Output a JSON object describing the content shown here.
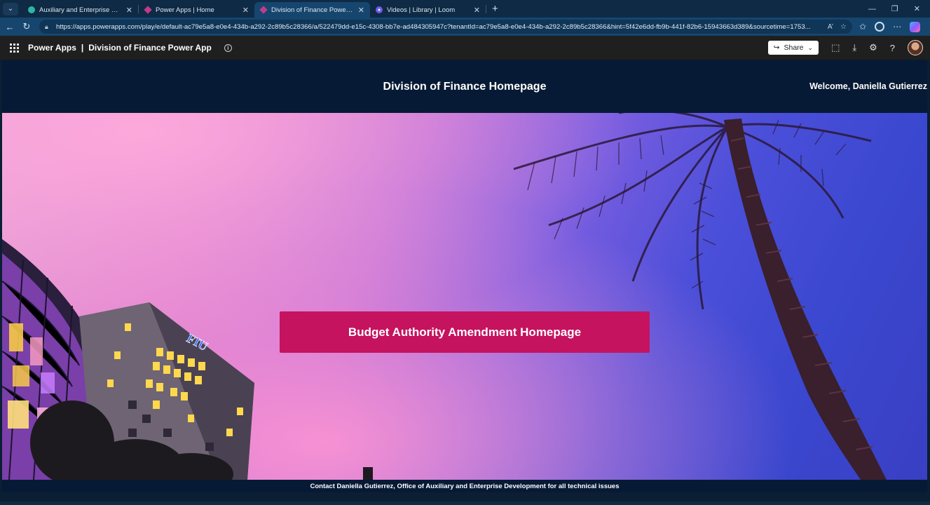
{
  "browser": {
    "tabs": [
      {
        "title": "Auxiliary and Enterprise Develope",
        "active": false,
        "favicon_color": "#2fb5a6"
      },
      {
        "title": "Power Apps | Home",
        "active": false,
        "favicon_color": "#c13b8a"
      },
      {
        "title": "Division of Finance Power App - P",
        "active": true,
        "favicon_color": "#c13b8a"
      },
      {
        "title": "Videos | Library | Loom",
        "active": false,
        "favicon_color": "#6c5ce7"
      }
    ],
    "url": "https://apps.powerapps.com/play/e/default-ac79e5a8-e0e4-434b-a292-2c89b5c28366/a/522479dd-e15c-4308-bb7e-ad484305947c?tenantId=ac79e5a8-e0e4-434b-a292-2c89b5c28366&hint=5f42e6dd-fb9b-441f-82b6-15943663d389&sourcetime=1753..."
  },
  "powerapps": {
    "product": "Power Apps",
    "separator": "|",
    "app_name": "Division of Finance Power App",
    "share_label": "Share"
  },
  "app": {
    "title": "Division of Finance Homepage",
    "welcome": "Welcome, Daniella Gutierrez",
    "cta_label": "Budget Authority Amendment Homepage",
    "sign_text": "FIU",
    "footer": "Contact Daniella Gutierrez, Office of Auxiliary and Enterprise Development for all technical issues"
  },
  "colors": {
    "header_bg": "#071a35",
    "cta_bg": "#c5135f",
    "browser_chrome": "#16466e"
  }
}
